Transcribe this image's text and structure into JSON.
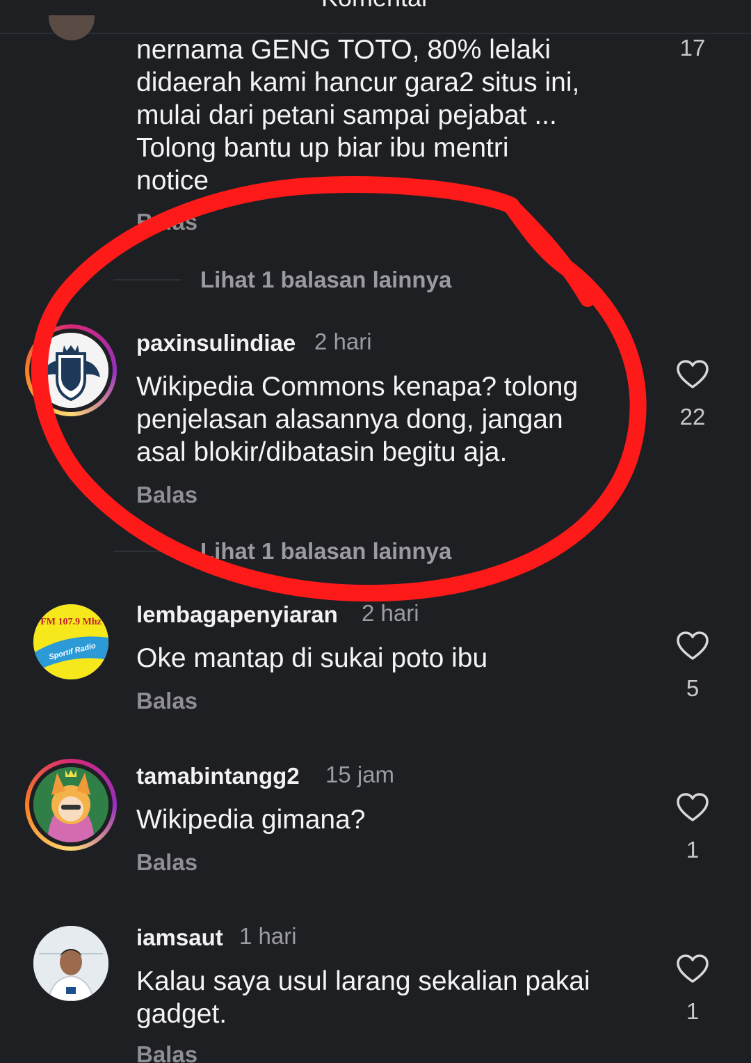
{
  "header": {
    "title": "Komentar"
  },
  "comments": [
    {
      "username": "",
      "time": "",
      "text": "nernama GENG TOTO, 80% lelaki\ndidaerah kami hancur gara2 situs ini,\nmulai dari petani sampai pejabat ...\nTolong bantu up biar ibu mentri\nnotice",
      "reply_label": "Balas",
      "likes": "17",
      "view_replies": "Lihat 1 balasan lainnya"
    },
    {
      "username": "paxinsulindiae",
      "time": "2 hari",
      "text": "Wikipedia Commons kenapa? tolong\npenjelasan alasannya dong, jangan\nasal blokir/dibatasin begitu aja.",
      "reply_label": "Balas",
      "likes": "22",
      "view_replies": "Lihat 1 balasan lainnya"
    },
    {
      "username": "lembagapenyiaran",
      "time": "2 hari",
      "text": "Oke mantap di sukai poto ibu",
      "reply_label": "Balas",
      "likes": "5",
      "avatar_text_top": "FM 107.9 Mhz",
      "avatar_text_bottom": "Sportif Radio"
    },
    {
      "username": "tamabintangg2",
      "time": "15 jam",
      "text": "Wikipedia gimana?",
      "reply_label": "Balas",
      "likes": "1"
    },
    {
      "username": "iamsaut",
      "time": "1 hari",
      "text": "Kalau saya usul larang sekalian pakai\ngadget.",
      "reply_label": "Balas",
      "likes": "1"
    }
  ],
  "icons": {
    "like": "heart-outline-icon"
  },
  "colors": {
    "background": "#1e1f23",
    "annotation_circle": "#ff1a1a",
    "story_ring": "#d62976"
  }
}
